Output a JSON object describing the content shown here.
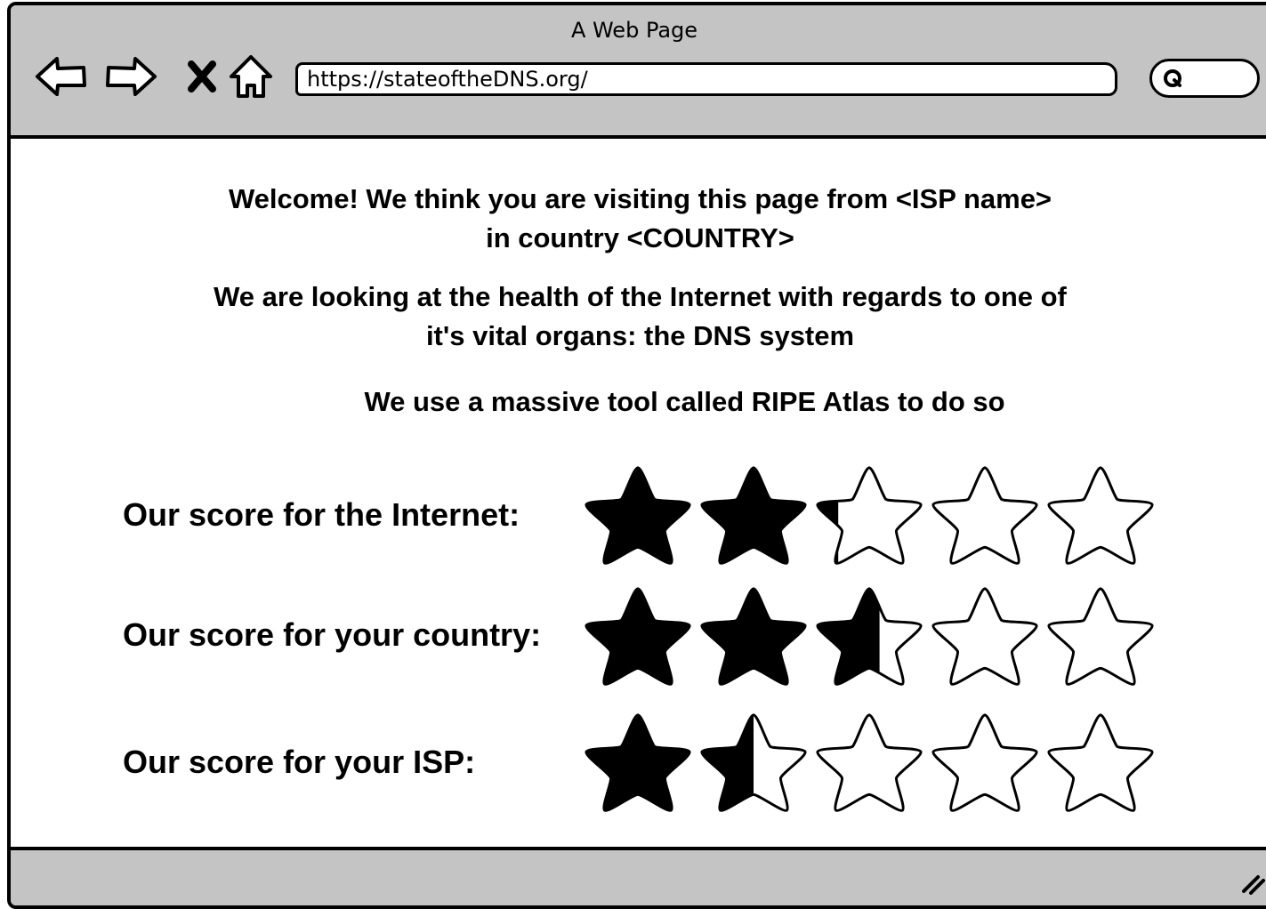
{
  "window": {
    "title": "A Web Page"
  },
  "toolbar": {
    "back_icon": "back-arrow-icon",
    "forward_icon": "forward-arrow-icon",
    "stop_icon": "close-icon",
    "home_icon": "home-icon",
    "url": "https://stateoftheDNS.org/",
    "search_icon": "search-icon"
  },
  "main": {
    "welcome_line1": "Welcome! We think you are visiting this page from <ISP name>",
    "welcome_line2": "in country <COUNTRY>",
    "health_line1": "We are looking at the health of the Internet with regards to one of",
    "health_line2": "it's vital organs: the DNS system",
    "tool_line": "We use a massive tool called RIPE Atlas to do so",
    "scores": [
      {
        "label": "Our score for the Internet:",
        "rating": 2.2,
        "max": 5
      },
      {
        "label": "Our score for your country:",
        "rating": 2.6,
        "max": 5
      },
      {
        "label": "Our score for your ISP:",
        "rating": 1.5,
        "max": 5
      }
    ]
  },
  "colors": {
    "chrome": "#c4c4c4",
    "star_fill": "#000000"
  }
}
